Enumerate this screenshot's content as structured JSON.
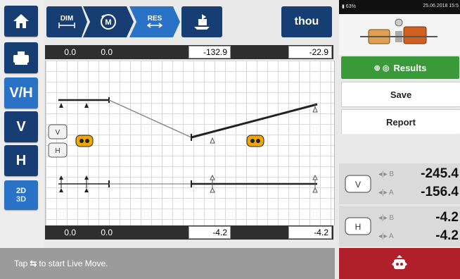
{
  "sidebar": {
    "view_vh": "V/H",
    "view_v": "V",
    "view_h": "H",
    "mode_2d": "2D",
    "mode_3d": "3D"
  },
  "toolbar": {
    "dim_label": "DIM",
    "res_label": "RES",
    "units_label": "thou"
  },
  "vertical_readouts": {
    "left_a": "0.0",
    "left_b": "0.0",
    "center": "-132.9",
    "right": "-22.9"
  },
  "horizontal_readouts": {
    "left_a": "0.0",
    "left_b": "0.0",
    "center": "-4.2",
    "right": "-4.2"
  },
  "status_bar": {
    "battery": "63%",
    "datetime": "25.06.2018 15:5"
  },
  "right_panel": {
    "results_label": "Results",
    "save_label": "Save",
    "report_label": "Report"
  },
  "results": {
    "vertical": [
      {
        "label": "B",
        "value": "-245.4"
      },
      {
        "label": "A",
        "value": "-156.4"
      }
    ],
    "horizontal": [
      {
        "label": "B",
        "value": "-4.2"
      },
      {
        "label": "A",
        "value": "-4.2"
      }
    ]
  },
  "footer": {
    "hint_prefix": "Tap",
    "hint_suffix": "to start Live Move."
  },
  "colors": {
    "navy": "#173e72",
    "active_blue": "#2a72c6",
    "results_green": "#3a9a3a",
    "live_move_red": "#b01f2a",
    "foot_orange": "#f0a800"
  }
}
